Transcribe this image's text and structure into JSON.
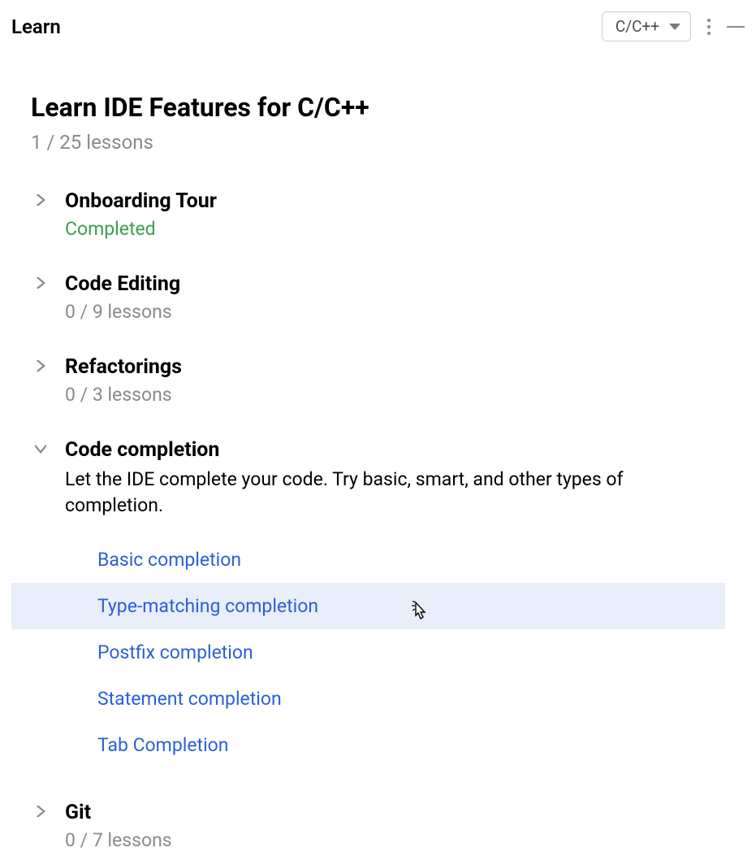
{
  "header": {
    "title": "Learn",
    "lang_selector": "C/C++"
  },
  "main": {
    "title": "Learn IDE Features for C/C++",
    "progress": "1 / 25 lessons"
  },
  "sections": [
    {
      "title": "Onboarding Tour",
      "subtitle": "Completed",
      "completed": true,
      "expanded": false
    },
    {
      "title": "Code Editing",
      "subtitle": "0 / 9 lessons",
      "completed": false,
      "expanded": false
    },
    {
      "title": "Refactorings",
      "subtitle": "0 / 3 lessons",
      "completed": false,
      "expanded": false
    },
    {
      "title": "Code completion",
      "description": "Let the IDE complete your code. Try basic, smart, and other types of completion.",
      "expanded": true,
      "lessons": [
        {
          "label": "Basic completion",
          "highlighted": false
        },
        {
          "label": "Type-matching completion",
          "highlighted": true
        },
        {
          "label": "Postfix completion",
          "highlighted": false
        },
        {
          "label": "Statement completion",
          "highlighted": false
        },
        {
          "label": "Tab Completion",
          "highlighted": false
        }
      ]
    },
    {
      "title": "Git",
      "subtitle": "0 / 7 lessons",
      "completed": false,
      "expanded": false
    }
  ]
}
